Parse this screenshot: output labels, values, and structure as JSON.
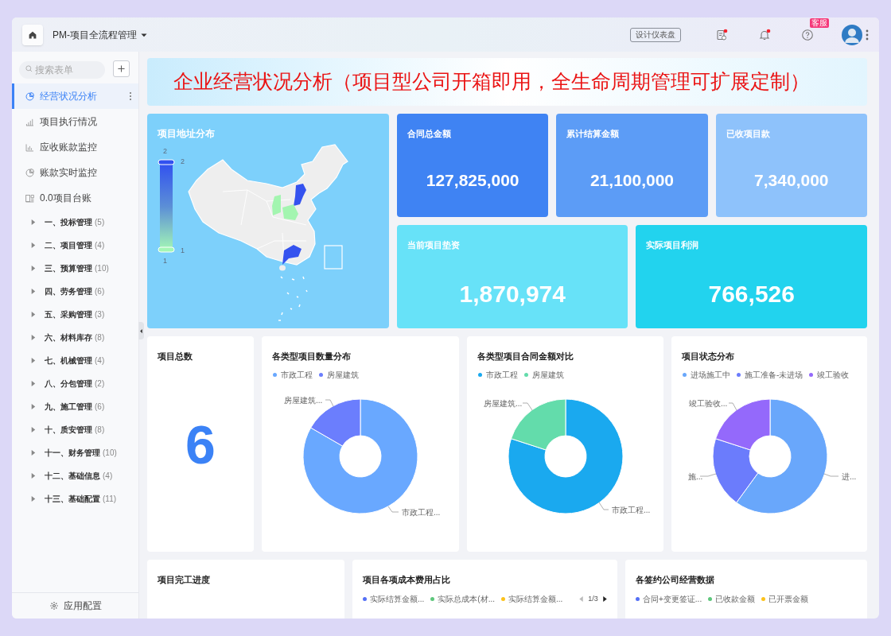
{
  "topbar": {
    "app_title": "PM-项目全流程管理",
    "design_button": "设计仪表盘",
    "support_badge": "客服"
  },
  "sidebar": {
    "search": {
      "placeholder": "搜索表单"
    },
    "nav": [
      {
        "label": "经营状况分析",
        "selected": true
      },
      {
        "label": "项目执行情况",
        "selected": false
      },
      {
        "label": "应收账款监控",
        "selected": false
      },
      {
        "label": "账款实时监控",
        "selected": false
      },
      {
        "label": "0.0项目台账",
        "selected": false
      }
    ],
    "tree": [
      {
        "label": "一、投标管理",
        "count": "(5)",
        "expanded": false
      },
      {
        "label": "二、项目管理",
        "count": "(4)",
        "expanded": false
      },
      {
        "label": "三、预算管理",
        "count": "(10)",
        "expanded": false
      },
      {
        "label": "四、劳务管理",
        "count": "(6)",
        "expanded": false
      },
      {
        "label": "五、采购管理",
        "count": "(3)",
        "expanded": false
      },
      {
        "label": "六、材料库存",
        "count": "(8)",
        "expanded": false
      },
      {
        "label": "七、机械管理",
        "count": "(4)",
        "expanded": false
      },
      {
        "label": "八、分包管理",
        "count": "(2)",
        "expanded": false
      },
      {
        "label": "九、施工管理",
        "count": "(6)",
        "expanded": false
      },
      {
        "label": "十、质安管理",
        "count": "(8)",
        "expanded": false
      },
      {
        "label": "十一、财务管理",
        "count": "(10)",
        "expanded": false
      },
      {
        "label": "十二、基础信息",
        "count": "(4)",
        "expanded": false
      },
      {
        "label": "十三、基础配置",
        "count": "(11)",
        "expanded": false
      }
    ],
    "footer": "应用配置"
  },
  "banner": "企业经营状况分析（项目型公司开箱即用，全生命周期管理可扩展定制）",
  "map_card": {
    "title": "项目地址分布",
    "scale": {
      "top_label": "2",
      "high_label": "2",
      "low_label": "1",
      "bottom_label": "1"
    }
  },
  "kpis": [
    {
      "label": "合同总金额",
      "value": "127,825,000",
      "color": "#3f83f3"
    },
    {
      "label": "累计结算金额",
      "value": "21,100,000",
      "color": "#5c9cf6"
    },
    {
      "label": "已收项目款",
      "value": "7,340,000",
      "color": "#8ec2fb"
    },
    {
      "label": "当前项目垫资",
      "value": "1,870,974",
      "color": "#67e2f8"
    },
    {
      "label": "实际项目利润",
      "value": "766,526",
      "color": "#22d3ee"
    }
  ],
  "total_card": {
    "title": "项目总数",
    "value": "6"
  },
  "donuts": [
    {
      "title": "各类型项目数量分布",
      "legend": [
        {
          "label": "市政工程",
          "color": "#69a8ff",
          "callout": "市政工程..."
        },
        {
          "label": "房屋建筑",
          "color": "#6b7efd",
          "callout": "房屋建筑..."
        }
      ]
    },
    {
      "title": "各类型项目合同金额对比",
      "legend": [
        {
          "label": "市政工程",
          "color": "#1aa9ef",
          "callout": "市政工程..."
        },
        {
          "label": "房屋建筑",
          "color": "#63dcab",
          "callout": "房屋建筑..."
        }
      ]
    },
    {
      "title": "项目状态分布",
      "legend": [
        {
          "label": "进场施工中",
          "color": "#69a7fb",
          "callout": "进..."
        },
        {
          "label": "施工准备-未进场",
          "color": "#6b7cfc",
          "callout": "施..."
        },
        {
          "label": "竣工验收",
          "color": "#9469fb",
          "callout": "竣工验收..."
        }
      ]
    }
  ],
  "bottom_cards": [
    {
      "title": "项目完工进度"
    },
    {
      "title": "项目各项成本费用占比",
      "legend": [
        {
          "label": "实际结算金额...",
          "color": "#5470f6"
        },
        {
          "label": "实际总成本(材...",
          "color": "#5ec77c"
        },
        {
          "label": "实际结算金额...",
          "color": "#fcc21b"
        }
      ],
      "pager": "1/3"
    },
    {
      "title": "各签约公司经营数据",
      "legend": [
        {
          "label": "合同+变更签证...",
          "color": "#5470f6"
        },
        {
          "label": "已收款金额",
          "color": "#5ec77c"
        },
        {
          "label": "已开票金额",
          "color": "#fcc21b"
        }
      ]
    }
  ]
}
